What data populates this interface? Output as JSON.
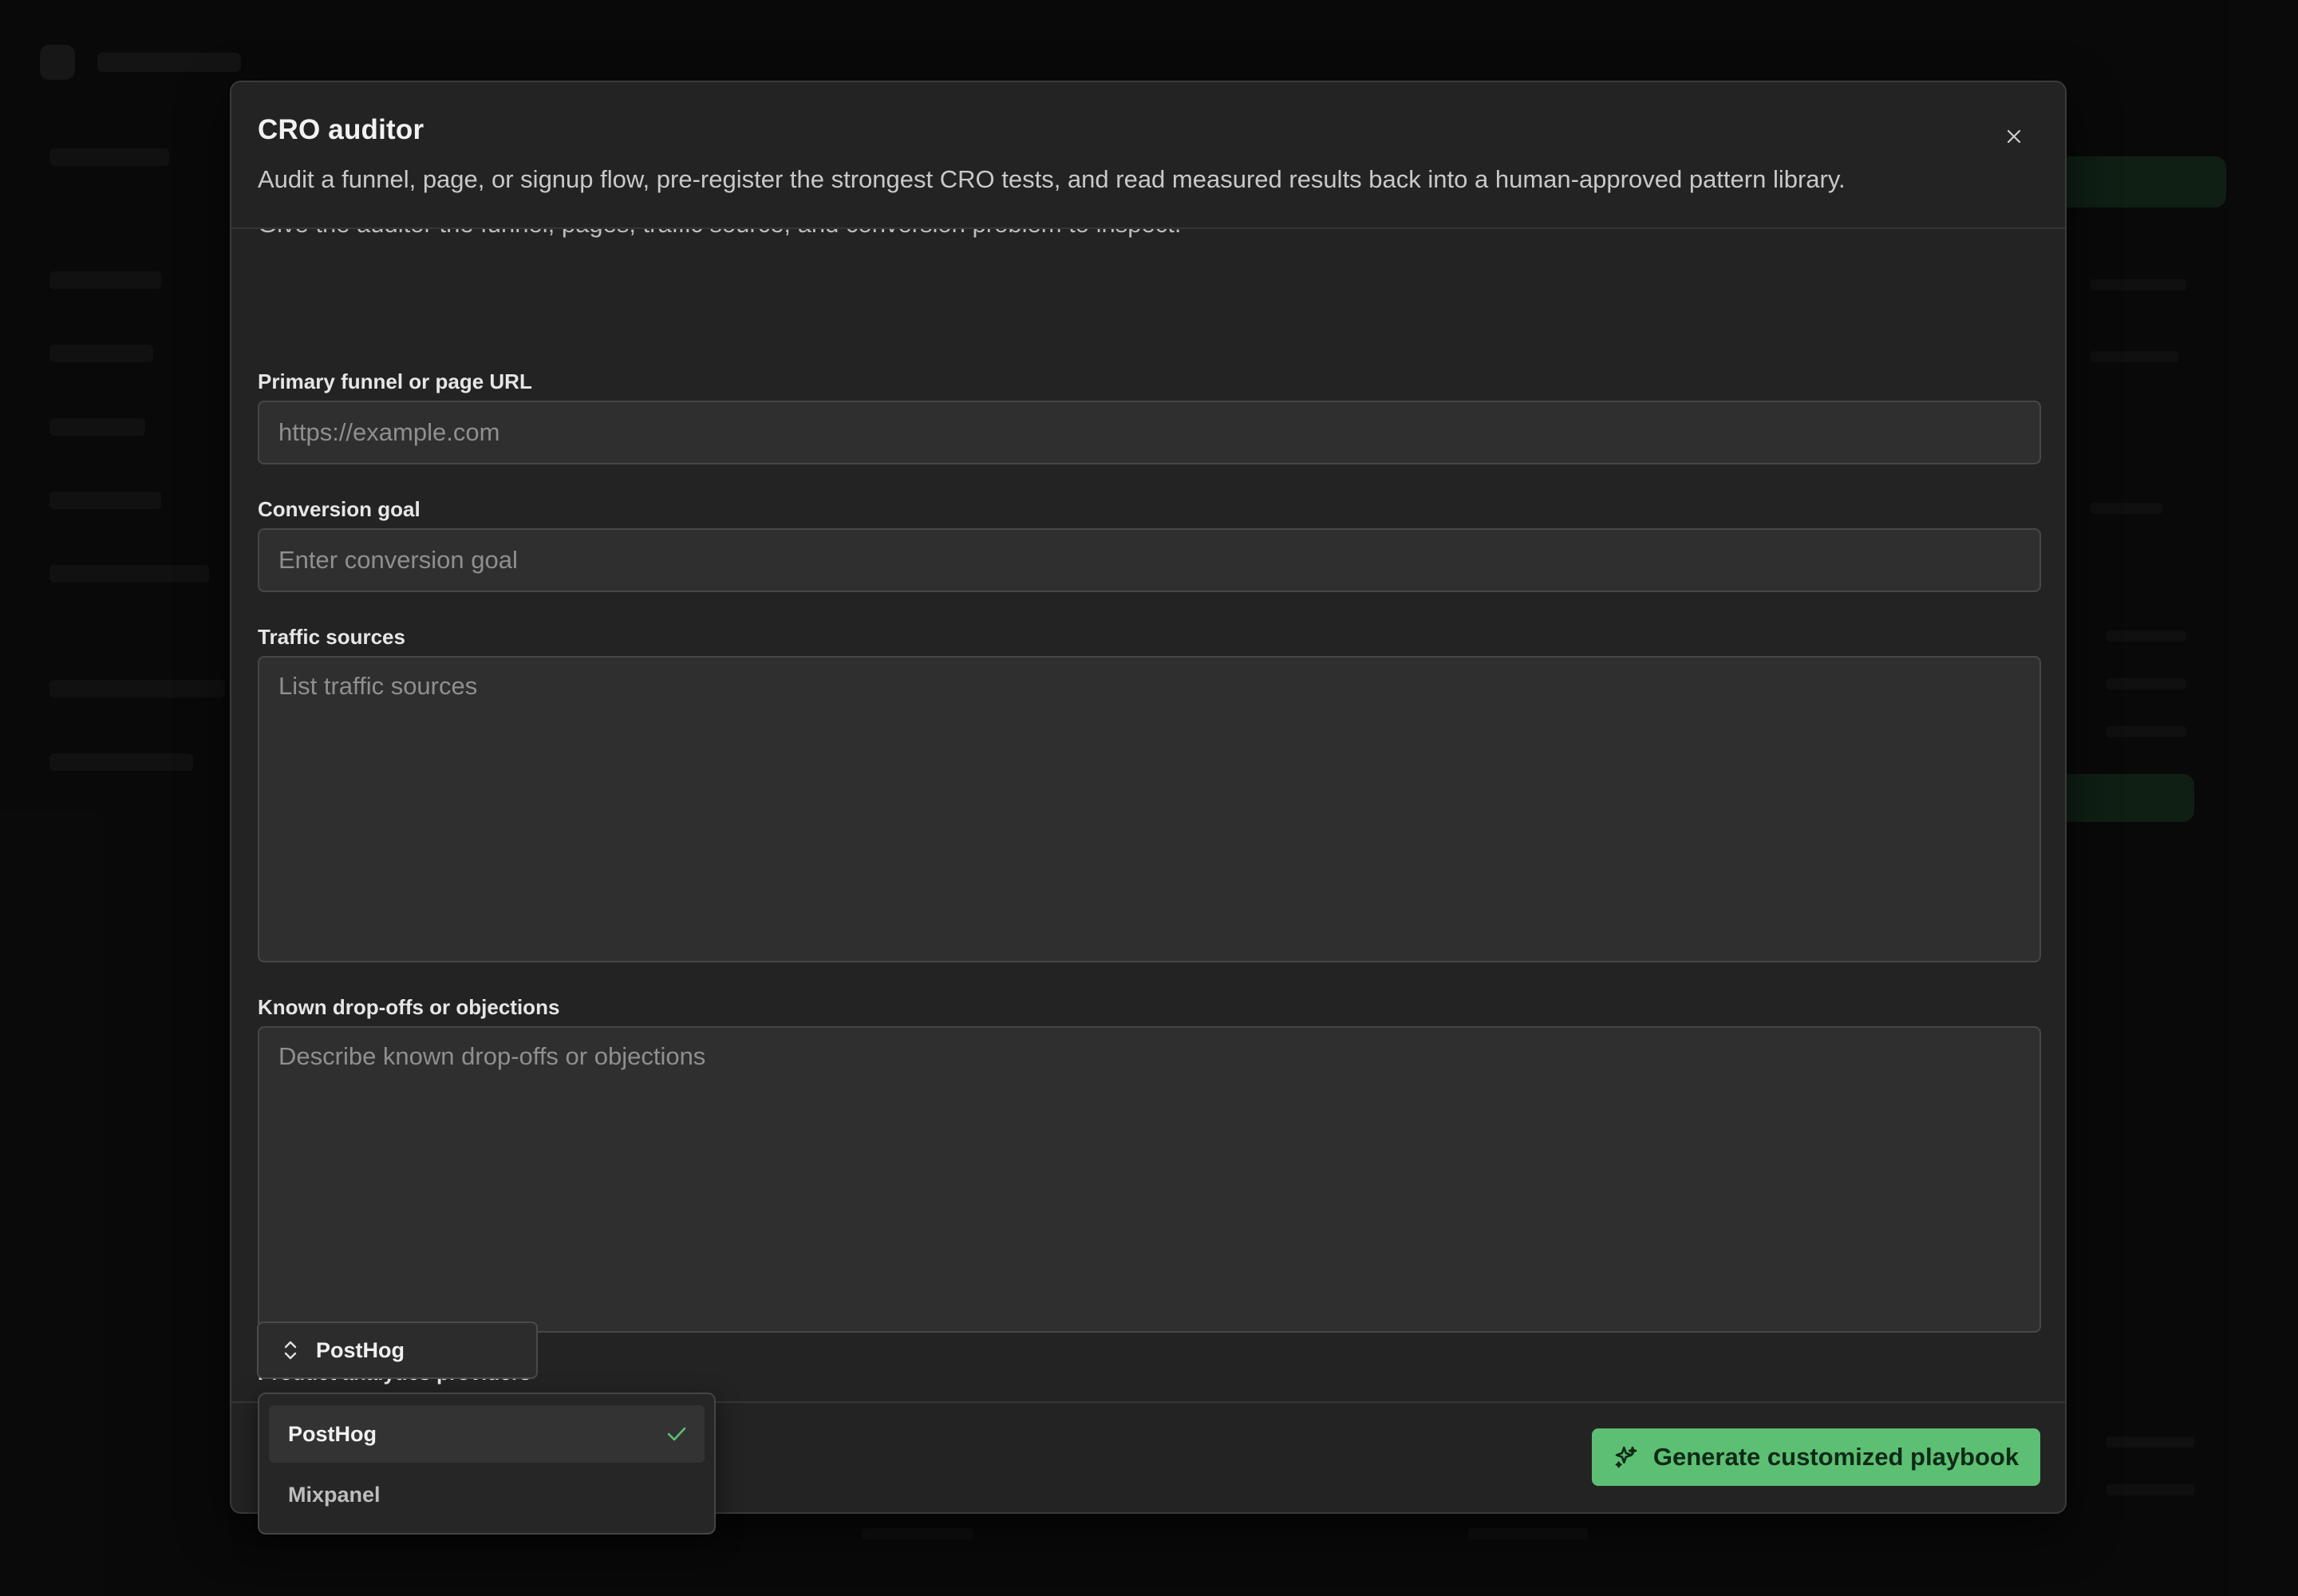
{
  "modal": {
    "title": "CRO auditor",
    "description": "Audit a funnel, page, or signup flow, pre-register the strongest CRO tests, and read measured results back into a human-approved pattern library.",
    "intro": "Give the auditor the funnel, pages, traffic source, and conversion problem to inspect.",
    "close_icon": "close-icon"
  },
  "form": {
    "url": {
      "label": "Primary funnel or page URL",
      "placeholder": "https://example.com",
      "value": ""
    },
    "goal": {
      "label": "Conversion goal",
      "placeholder": "Enter conversion goal",
      "value": ""
    },
    "traffic": {
      "label": "Traffic sources",
      "placeholder": "List traffic sources",
      "value": ""
    },
    "dropoffs": {
      "label": "Known drop-offs or objections",
      "placeholder": "Describe known drop-offs or objections",
      "value": ""
    },
    "analytics": {
      "label": "Product analytics providers",
      "selected": "PostHog",
      "options": [
        {
          "label": "PostHog",
          "selected": true
        },
        {
          "label": "Mixpanel",
          "selected": false
        }
      ]
    }
  },
  "footer": {
    "generate_label": "Generate customized playbook",
    "generate_icon": "sparkles-icon"
  },
  "colors": {
    "accent": "#5dbf73",
    "modal_bg": "#232323",
    "input_bg": "#2f2f2f"
  }
}
